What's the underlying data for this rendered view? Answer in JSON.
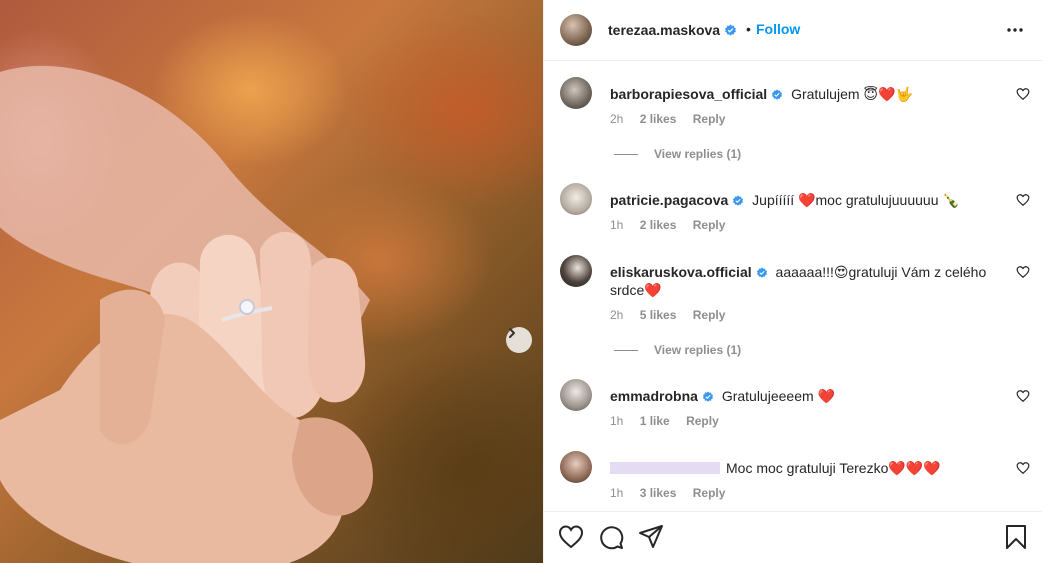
{
  "post": {
    "author": "terezaa.maskova",
    "separator": "•",
    "follow_label": "Follow"
  },
  "comments": [
    {
      "user": "barborapiesova_official",
      "text": "Gratulujem 😇❤️🤟",
      "time": "2h",
      "likes": "2 likes",
      "reply": "Reply",
      "view_replies": "View replies (1)"
    },
    {
      "user": "patricie.pagacova",
      "text": "Jupííííí ❤️moc gratulujuuuuuu 🍾",
      "time": "1h",
      "likes": "2 likes",
      "reply": "Reply"
    },
    {
      "user": "eliskaruskova.official",
      "text": "aaaaaa!!!😍gratuluji Vám z celého srdce❤️",
      "time": "2h",
      "likes": "5 likes",
      "reply": "Reply",
      "view_replies": "View replies (1)"
    },
    {
      "user": "emmadrobna",
      "text": "Gratulujeeeem ❤️",
      "time": "1h",
      "likes": "1 like",
      "reply": "Reply"
    },
    {
      "user": "",
      "text": "Moc moc gratuluji Terezko❤️❤️❤️",
      "time": "1h",
      "likes": "3 likes",
      "reply": "Reply"
    }
  ],
  "icons": {
    "like": "heart-icon",
    "comment": "comment-icon",
    "share": "share-icon",
    "save": "bookmark-icon",
    "more": "more-options-icon",
    "next": "chevron-right-icon",
    "verified": "verified-badge-icon"
  },
  "colors": {
    "accent": "#0095f6",
    "verified": "#3897f0",
    "muted": "#8e8e8e",
    "text": "#262626"
  }
}
